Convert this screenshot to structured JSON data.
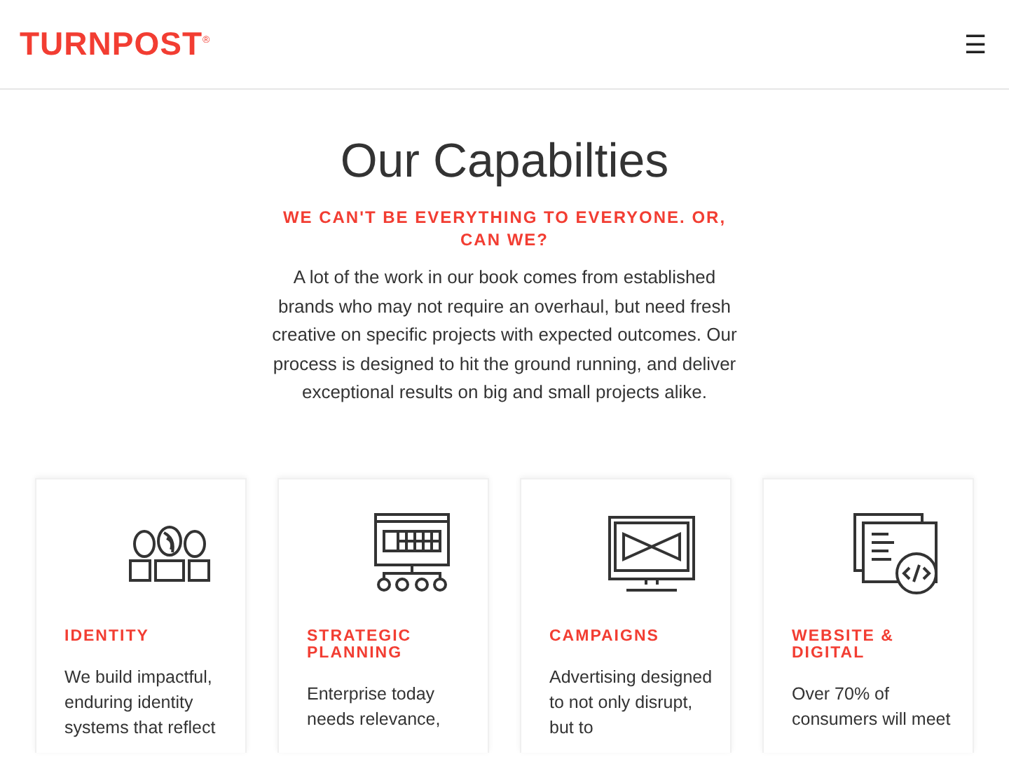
{
  "header": {
    "logo": "TURNPOST",
    "logo_mark": "®",
    "menu_icon": "☰"
  },
  "intro": {
    "title": "Our Capabilties",
    "subtitle": "WE CAN'T BE EVERYTHING TO EVERYONE. OR, CAN WE?",
    "body": "A lot of the work in our book comes from established brands who may not require an overhaul, but need fresh creative on specific projects with expected outcomes. Our process is designed to hit the ground running, and deliver exceptional results on big and small projects alike."
  },
  "cards": [
    {
      "kind": "identity",
      "title": "IDENTITY",
      "text": "We build impactful, enduring identity systems that reflect"
    },
    {
      "kind": "planning",
      "title": "STRATEGIC PLANNING",
      "text": "Enterprise today needs relevance,"
    },
    {
      "kind": "campaigns",
      "title": "CAMPAIGNS",
      "text": "Advertising designed to not only disrupt, but to"
    },
    {
      "kind": "web",
      "title": "WEBSITE & DIGITAL",
      "text": "Over 70% of consumers will meet"
    }
  ]
}
